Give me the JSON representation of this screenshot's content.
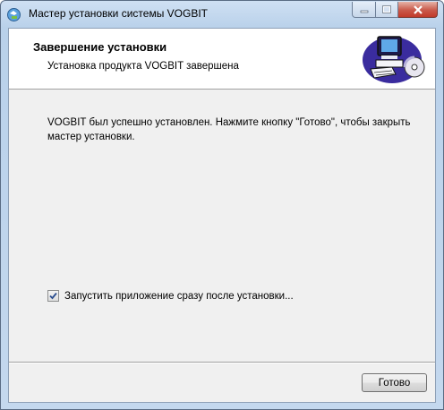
{
  "window": {
    "title": "Мастер установки системы VOGBIT",
    "buttons": {
      "minimize": "minimize-icon",
      "maximize": "maximize-icon",
      "close": "close-icon"
    }
  },
  "banner": {
    "title": "Завершение установки",
    "subtitle": "Установка продукта VOGBIT завершена",
    "image": "computer-cd-icon"
  },
  "body": {
    "message": "VOGBIT был успешно установлен. Нажмите кнопку \"Готово\", чтобы закрыть мастер установки."
  },
  "launch_option": {
    "label": "Запустить приложение сразу после установки...",
    "checked": true
  },
  "footer": {
    "finish_label": "Готово"
  },
  "colors": {
    "close_button": "#c9594a",
    "titlebar": "#b9d1ea"
  }
}
